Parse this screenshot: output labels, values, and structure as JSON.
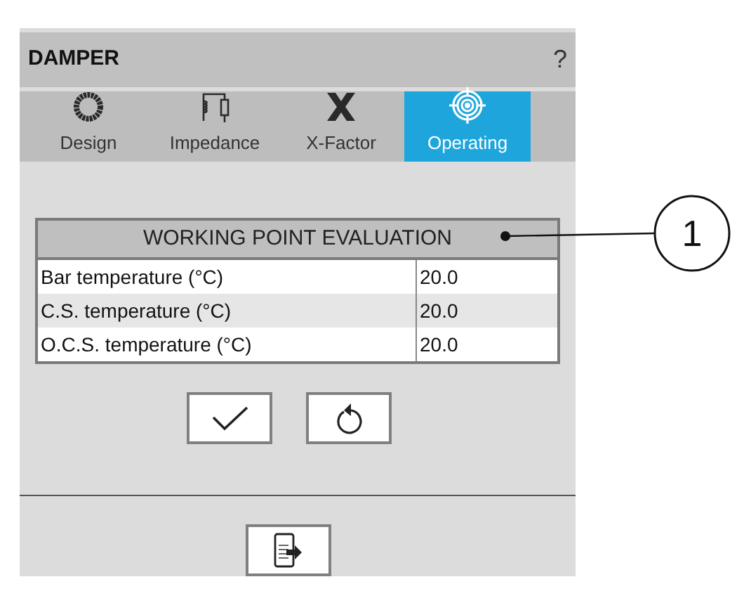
{
  "window": {
    "title": "DAMPER",
    "help": "?"
  },
  "tabs": [
    {
      "label": "Design",
      "kind": "ring",
      "selected": false
    },
    {
      "label": "Impedance",
      "kind": "coil",
      "selected": false
    },
    {
      "label": "X-Factor",
      "kind": "x",
      "selected": false
    },
    {
      "label": "Operating",
      "kind": "target",
      "selected": true
    }
  ],
  "table": {
    "title": "WORKING POINT EVALUATION",
    "rows": [
      {
        "label": "Bar temperature (°C)",
        "value": "20.0"
      },
      {
        "label": "C.S. temperature (°C)",
        "value": "20.0"
      },
      {
        "label": "O.C.S. temperature (°C)",
        "value": "20.0"
      }
    ]
  },
  "buttons": [
    {
      "kind": "confirm"
    },
    {
      "kind": "reset"
    }
  ],
  "footer_buttons": [
    {
      "kind": "export"
    }
  ],
  "callout": {
    "label": "1"
  }
}
